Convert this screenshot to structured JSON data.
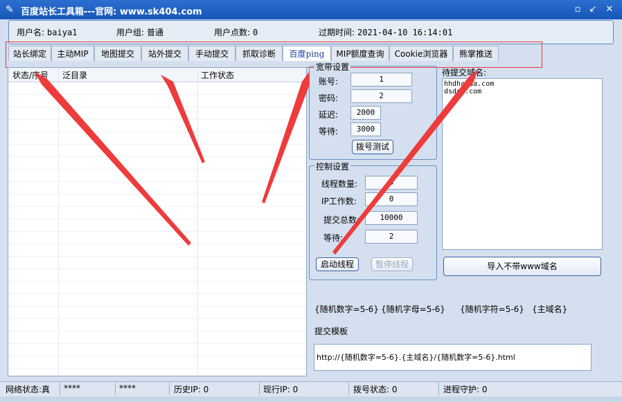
{
  "window": {
    "title": "百度站长工具箱---官网: www.sk404.com",
    "icon": "app-icon",
    "controls": {
      "restore": "▫",
      "minimize": "↙",
      "maximize": "↗",
      "close": "✕"
    }
  },
  "info": {
    "username_label": "用户名:",
    "username": "baiya1",
    "group_label": "用户组:",
    "group": "普通",
    "points_label": "用户点数:",
    "points": "0",
    "expire_label": "过期时间:",
    "expire": "2021-04-10 16:14:01"
  },
  "tabs": [
    {
      "label": "站长绑定"
    },
    {
      "label": "主动MIP"
    },
    {
      "label": "地图提交"
    },
    {
      "label": "站外提交"
    },
    {
      "label": "手动提交"
    },
    {
      "label": "抓取诊断"
    },
    {
      "label": "百度ping"
    },
    {
      "label": "MIP额度查询"
    },
    {
      "label": "Cookie浏览器"
    },
    {
      "label": "熊掌推送"
    }
  ],
  "active_tab": "百度ping",
  "list": {
    "columns": [
      "状态/序号",
      "泛目录",
      "工作状态"
    ]
  },
  "broadband": {
    "title": "宽带设置",
    "account_label": "账号:",
    "account": "1",
    "password_label": "密码:",
    "password": "2",
    "delay_label": "延迟:",
    "delay": "2000",
    "wait_label": "等待:",
    "wait": "3000",
    "dial_button": "拨号测试"
  },
  "control": {
    "title": "控制设置",
    "threads_label": "线程数量:",
    "threads": "5",
    "ip_label": "IP工作数:",
    "ip": "0",
    "total_label": "提交总数:",
    "total": "10000",
    "wait_label": "等待:",
    "wait": "2",
    "start_button": "启动线程",
    "pause_button": "暂停线程"
  },
  "domains": {
    "label": "待提交域名:",
    "lines": [
      "hhdhahda.com",
      "dsdsd.com"
    ],
    "import_button": "导入不带www域名"
  },
  "tokens": [
    "{随机数字=5-6}",
    "{随机字母=5-6}",
    "{随机字符=5-6}",
    "{主域名}"
  ],
  "template": {
    "label": "提交模板",
    "value": "http://{随机数字=5-6}.{主域名}/{随机数字=5-6}.html"
  },
  "status": {
    "net_label": "网络状态:",
    "net_value": "真",
    "mask1": "****",
    "mask2": "****",
    "history_label": "历史IP:",
    "history": "0",
    "current_label": "现行IP:",
    "current": "0",
    "dial_label": "拨号状态:",
    "dial": "0",
    "guard_label": "进程守护:",
    "guard": "0"
  },
  "colors": {
    "titlebar": "#1a5fc3",
    "highlight": "#e33333",
    "background": "#d4e0ef"
  }
}
